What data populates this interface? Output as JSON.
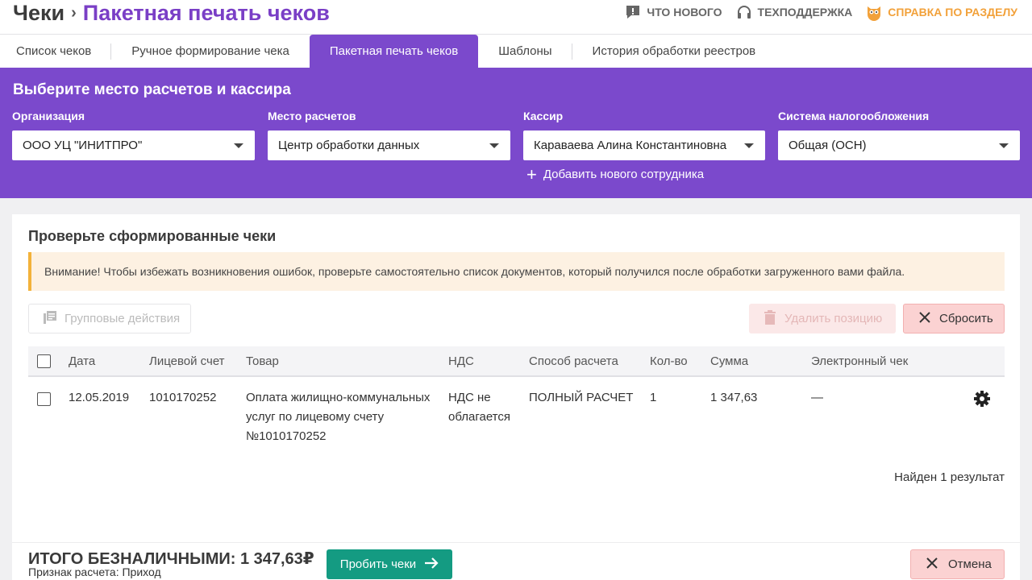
{
  "header": {
    "root": "Чеки",
    "separator": "›",
    "current": "Пакетная печать чеков",
    "links": [
      {
        "label": "Что нового",
        "icon": "chat-icon"
      },
      {
        "label": "Техподдержка",
        "icon": "headset-icon"
      },
      {
        "label": "Справка по разделу",
        "icon": "owl-icon"
      }
    ]
  },
  "tabs": [
    {
      "label": "Список чеков",
      "active": false
    },
    {
      "label": "Ручное формирование чека",
      "active": false
    },
    {
      "label": "Пакетная печать чеков",
      "active": true
    },
    {
      "label": "Шаблоны",
      "active": false
    },
    {
      "label": "История обработки реестров",
      "active": false
    }
  ],
  "settings": {
    "title": "Выберите место расчетов и кассира",
    "organization": {
      "label": "Организация",
      "value": "ООО УЦ \"ИНИТПРО\""
    },
    "place": {
      "label": "Место расчетов",
      "value": "Центр обработки данных"
    },
    "cashier": {
      "label": "Кассир",
      "value": "Караваева Алина Константиновна"
    },
    "tax": {
      "label": "Система налогообложения",
      "value": "Общая (ОСН)"
    },
    "add_employee": "Добавить нового сотрудника"
  },
  "check": {
    "title": "Проверьте сформированные чеки",
    "warning": "Внимание! Чтобы избежать возникновения ошибок, проверьте самостоятельно список документов, который получился после обработки загруженного вами файла.",
    "group_actions": "Групповые действия",
    "delete_position": "Удалить позицию",
    "reset": "Сбросить",
    "columns": [
      "Дата",
      "Лицевой счет",
      "Товар",
      "НДС",
      "Способ расчета",
      "Кол-во",
      "Сумма",
      "Электронный чек"
    ],
    "rows": [
      {
        "date": "12.05.2019",
        "account": "1010170252",
        "product": "Оплата жилищно-коммунальных услуг по лицевому счету №1010170252",
        "vat": "НДС не облагается",
        "method": "ПОЛНЫЙ РАСЧЕТ",
        "qty": "1",
        "sum": "1 347,63",
        "echeck": "—"
      }
    ],
    "found": "Найден 1 результат"
  },
  "footer": {
    "total": "ИТОГО БЕЗНАЛИЧНЫМИ: 1 347,63₽",
    "sign": "Признак расчета: Приход",
    "submit": "Пробить чеки",
    "cancel": "Отмена"
  },
  "colors": {
    "accent": "#7b49cc",
    "submit": "#149b82",
    "warning_border": "#f3b23a",
    "help_link": "#f2a13a"
  }
}
